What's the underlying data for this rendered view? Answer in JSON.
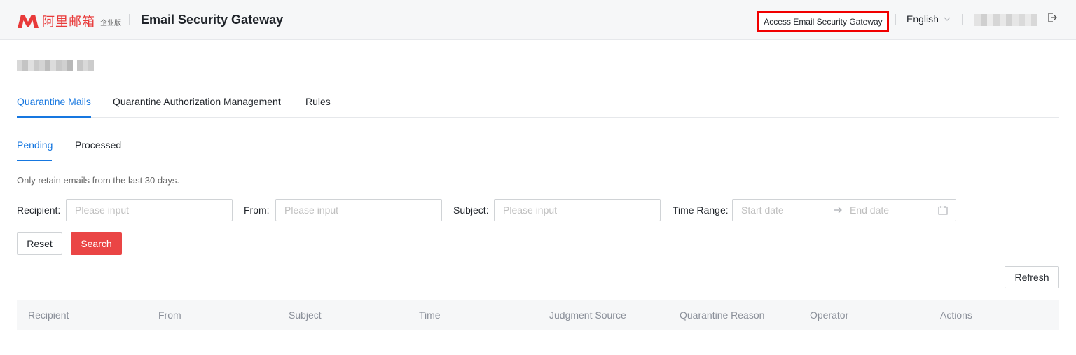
{
  "header": {
    "logo_cn": "阿里邮箱",
    "logo_edition": "企业版",
    "app_title": "Email Security Gateway",
    "access_button": "Access Email Security Gateway",
    "language": "English",
    "brand_color": "#e83a3a"
  },
  "tabs": [
    {
      "label": "Quarantine Mails",
      "active": true
    },
    {
      "label": "Quarantine Authorization Management",
      "active": false
    },
    {
      "label": "Rules",
      "active": false
    }
  ],
  "subtabs": [
    {
      "label": "Pending",
      "active": true
    },
    {
      "label": "Processed",
      "active": false
    }
  ],
  "note": "Only retain emails from the last 30 days.",
  "filters": {
    "recipient_label": "Recipient:",
    "from_label": "From:",
    "subject_label": "Subject:",
    "time_label": "Time Range:",
    "placeholder": "Please input",
    "start_placeholder": "Start date",
    "end_placeholder": "End date"
  },
  "buttons": {
    "reset": "Reset",
    "search": "Search",
    "refresh": "Refresh"
  },
  "table": {
    "columns": [
      "Recipient",
      "From",
      "Subject",
      "Time",
      "Judgment Source",
      "Quarantine Reason",
      "Operator",
      "Actions"
    ]
  },
  "colors": {
    "accent": "#1677e0",
    "primary_button": "#ea4545",
    "highlight_box": "#f10000"
  }
}
